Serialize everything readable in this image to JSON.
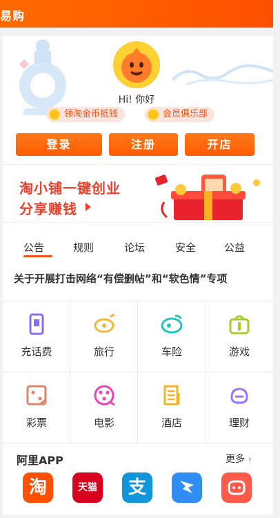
{
  "header": {
    "title": "易购"
  },
  "user": {
    "greeting": "Hi! 你好"
  },
  "pills": {
    "coin": "领淘金币抵钱",
    "club": "会员俱乐部"
  },
  "buttons": {
    "login": "登录",
    "register": "注册",
    "open_shop": "开店"
  },
  "banner": {
    "line1": "淘小铺一键创业",
    "line2": "分享赚钱"
  },
  "tabs": [
    "公告",
    "规则",
    "论坛",
    "安全",
    "公益"
  ],
  "notice": "关于开展打击网络“有偿删帖”和“软色情”专项",
  "services": [
    {
      "label": "充话费",
      "icon": "phone-icon",
      "color": "#8a6cf0"
    },
    {
      "label": "旅行",
      "icon": "travel-icon",
      "color": "#f6b738"
    },
    {
      "label": "车险",
      "icon": "car-icon",
      "color": "#1fc6c0"
    },
    {
      "label": "游戏",
      "icon": "game-icon",
      "color": "#a6cf2a"
    },
    {
      "label": "彩票",
      "icon": "lottery-icon",
      "color": "#d8846a"
    },
    {
      "label": "电影",
      "icon": "movie-icon",
      "color": "#f040b8"
    },
    {
      "label": "酒店",
      "icon": "hotel-icon",
      "color": "#f4b224"
    },
    {
      "label": "理财",
      "icon": "finance-icon",
      "color": "#9a74f2"
    }
  ],
  "apps": {
    "heading": "阿里APP",
    "more": "更多",
    "items": [
      {
        "name": "淘",
        "icon": "taobao-icon",
        "color": "#ff5000"
      },
      {
        "name": "天猫",
        "icon": "tmall-icon",
        "color": "#d7001e"
      },
      {
        "name": "支",
        "icon": "alipay-icon",
        "color": "#1296db"
      },
      {
        "name": "",
        "icon": "dingtalk-icon",
        "color": "#2f8df5"
      },
      {
        "name": "",
        "icon": "xianyu-icon",
        "color": "#ff5a4a"
      }
    ]
  },
  "colors": {
    "brand": "#ff5000",
    "accent": "#f2541b"
  }
}
